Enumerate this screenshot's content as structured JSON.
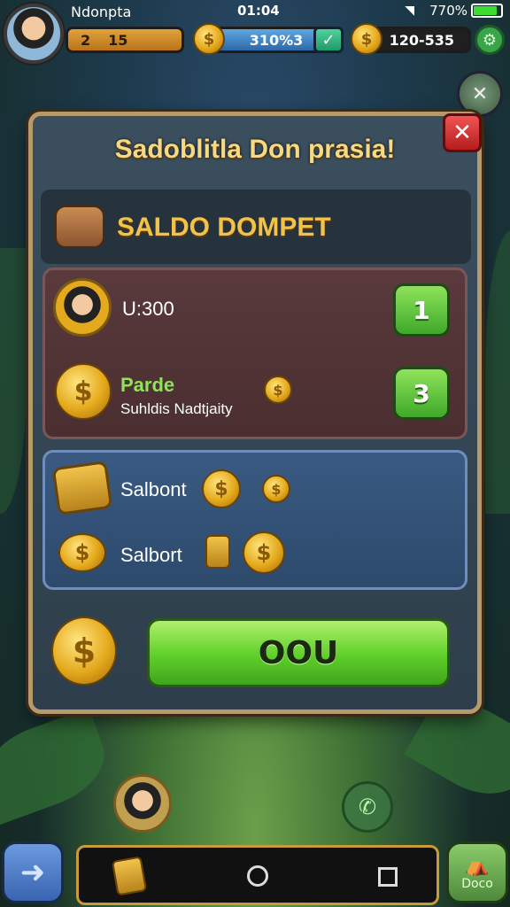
{
  "status_bar": {
    "app_name": "Ndonpta",
    "time": "01:04",
    "battery": "770%"
  },
  "hud": {
    "level_label": "2",
    "level_value": "15",
    "gems": "310%3",
    "gold": "120-535"
  },
  "dialog": {
    "title": "Sadoblitla Don prasia!",
    "close_label": "✕",
    "wallet_title": "SALDO DOMPET",
    "red_panel": {
      "row1_text": "U:300",
      "row1_button": "1",
      "row2_title": "Parde",
      "row2_subtitle": "Suhldis Nadtjaity",
      "row2_button": "3"
    },
    "blue_panel": {
      "row1_text": "Salbont",
      "row2_text": "Salbort"
    },
    "ok_button": "OOU"
  },
  "bottom": {
    "shop_label": "Doco",
    "nav_items": [
      "card-icon",
      "search-icon",
      "square-icon"
    ]
  },
  "colors": {
    "accent_green": "#5fcf2a",
    "gold": "#e4a91c",
    "frame": "#b79a6b"
  }
}
